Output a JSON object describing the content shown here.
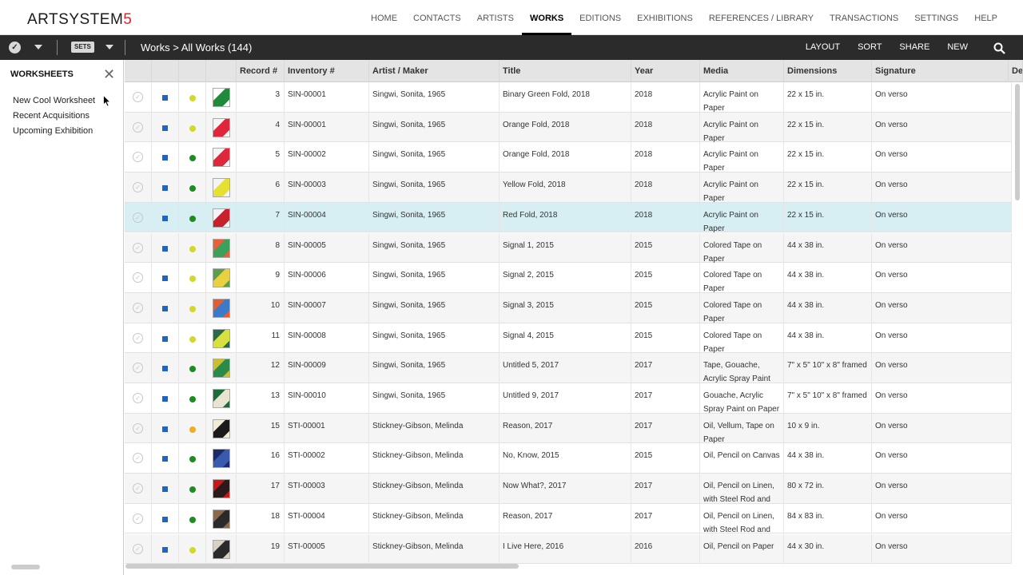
{
  "app": {
    "logo_text": "ARTSYSTEM",
    "logo_number": "5",
    "logo_number_color": "#e0242a"
  },
  "nav": {
    "items": [
      "HOME",
      "CONTACTS",
      "ARTISTS",
      "WORKS",
      "EDITIONS",
      "EXHIBITIONS",
      "REFERENCES / LIBRARY",
      "TRANSACTIONS",
      "SETTINGS",
      "HELP"
    ],
    "active": "WORKS"
  },
  "toolbar": {
    "sets_label": "SETS",
    "breadcrumb": "Works > All Works (144)",
    "actions": [
      "LAYOUT",
      "SORT",
      "SHARE",
      "NEW"
    ],
    "search_icon": "search-icon"
  },
  "sidebar": {
    "title": "WORKSHEETS",
    "close_icon": "close-icon",
    "items": [
      "New Cool Worksheet",
      "Recent Acquisitions",
      "Upcoming Exhibition"
    ]
  },
  "table": {
    "columns": [
      "",
      "",
      "",
      "",
      "Record #",
      "Inventory #",
      "Artist / Maker",
      "Title",
      "Year",
      "Media",
      "Dimensions",
      "Signature",
      "De"
    ],
    "colors": {
      "square": "#1b64c8",
      "green": "#1e8c1e",
      "yellow": "#d4d829",
      "orange": "#f0ad20",
      "selected_row": "#d7eff3"
    },
    "rows": [
      {
        "record": "3",
        "inventory": "SIN-00001",
        "artist": "Singwi, Sonita, 1965",
        "title": "Binary Green Fold, 2018",
        "year": "2018",
        "media": "Acrylic Paint on Paper",
        "dimensions": "22 x 15 in.",
        "signature": "On verso",
        "status": "yellow",
        "thumb": [
          "#ffffff",
          "#1f8a3a"
        ]
      },
      {
        "record": "4",
        "inventory": "SIN-00001",
        "artist": "Singwi, Sonita, 1965",
        "title": "Orange Fold, 2018",
        "year": "2018",
        "media": "Acrylic Paint on Paper",
        "dimensions": "22 x 15 in.",
        "signature": "On verso",
        "status": "yellow",
        "thumb": [
          "#f4f4f4",
          "#e0263a"
        ]
      },
      {
        "record": "5",
        "inventory": "SIN-00002",
        "artist": "Singwi, Sonita, 1965",
        "title": "Orange Fold, 2018",
        "year": "2018",
        "media": "Acrylic Paint on Paper",
        "dimensions": "22 x 15 in.",
        "signature": "On verso",
        "status": "green",
        "thumb": [
          "#f4f4f4",
          "#e0263a"
        ]
      },
      {
        "record": "6",
        "inventory": "SIN-00003",
        "artist": "Singwi, Sonita, 1965",
        "title": "Yellow Fold, 2018",
        "year": "2018",
        "media": "Acrylic Paint on Paper",
        "dimensions": "22 x 15 in.",
        "signature": "On verso",
        "status": "green",
        "thumb": [
          "#f4f4f4",
          "#e6e031"
        ]
      },
      {
        "record": "7",
        "inventory": "SIN-00004",
        "artist": "Singwi, Sonita, 1965",
        "title": "Red Fold, 2018",
        "year": "2018",
        "media": "Acrylic Paint on Paper",
        "dimensions": "22 x 15 in.",
        "signature": "On verso",
        "status": "green",
        "thumb": [
          "#f4f4f4",
          "#c8202c"
        ],
        "selected": true
      },
      {
        "record": "8",
        "inventory": "SIN-00005",
        "artist": "Singwi, Sonita, 1965",
        "title": "Signal 1, 2015",
        "year": "2015",
        "media": "Colored Tape on Paper",
        "dimensions": "44 x 38 in.",
        "signature": "On verso",
        "status": "yellow",
        "thumb": [
          "#e8603a",
          "#3aa05a"
        ]
      },
      {
        "record": "9",
        "inventory": "SIN-00006",
        "artist": "Singwi, Sonita, 1965",
        "title": "Signal 2, 2015",
        "year": "2015",
        "media": "Colored Tape on Paper",
        "dimensions": "44 x 38 in.",
        "signature": "On verso",
        "status": "yellow",
        "thumb": [
          "#5aa04a",
          "#e8d040"
        ]
      },
      {
        "record": "10",
        "inventory": "SIN-00007",
        "artist": "Singwi, Sonita, 1965",
        "title": "Signal 3, 2015",
        "year": "2015",
        "media": "Colored Tape on Paper",
        "dimensions": "44 x 38 in.",
        "signature": "On verso",
        "status": "yellow",
        "thumb": [
          "#e85a30",
          "#3a7ac8"
        ]
      },
      {
        "record": "11",
        "inventory": "SIN-00008",
        "artist": "Singwi, Sonita, 1965",
        "title": "Signal 4, 2015",
        "year": "2015",
        "media": "Colored Tape on Paper",
        "dimensions": "44 x 38 in.",
        "signature": "On verso",
        "status": "yellow",
        "thumb": [
          "#2a6a4a",
          "#d8e040"
        ]
      },
      {
        "record": "12",
        "inventory": "SIN-00009",
        "artist": "Singwi, Sonita, 1965",
        "title": "Untitled 5, 2017",
        "year": "2017",
        "media": "Tape, Gouache, Acrylic Spray Paint",
        "dimensions": "7\" x 5\" 10\" x 8\" framed",
        "signature": "On verso",
        "status": "green",
        "thumb": [
          "#c8c030",
          "#2a8a4a"
        ]
      },
      {
        "record": "13",
        "inventory": "SIN-00010",
        "artist": "Singwi, Sonita, 1965",
        "title": "Untitled 9, 2017",
        "year": "2017",
        "media": "Gouache, Acrylic Spray Paint on Paper",
        "dimensions": "7\" x 5\" 10\" x 8\" framed",
        "signature": "On verso",
        "status": "green",
        "thumb": [
          "#1f6a3a",
          "#e8e4d0"
        ]
      },
      {
        "record": "15",
        "inventory": "STI-00001",
        "artist": "Stickney-Gibson, Melinda",
        "title": "Reason, 2017",
        "year": "2017",
        "media": "Oil, Vellum, Tape on Paper",
        "dimensions": "10 x 9 in.",
        "signature": "On verso",
        "status": "orange",
        "thumb": [
          "#f0ecd8",
          "#1a1a1a"
        ]
      },
      {
        "record": "16",
        "inventory": "STI-00002",
        "artist": "Stickney-Gibson, Melinda",
        "title": "No, Know, 2015",
        "year": "2015",
        "media": "Oil, Pencil on Canvas",
        "dimensions": "44 x 38 in.",
        "signature": "On verso",
        "status": "green",
        "thumb": [
          "#1a2a6a",
          "#3a5ab0"
        ]
      },
      {
        "record": "17",
        "inventory": "STI-00003",
        "artist": "Stickney-Gibson, Melinda",
        "title": "Now What?, 2017",
        "year": "2017",
        "media": "Oil, Pencil on Linen, with Steel Rod and",
        "dimensions": "80 x 72 in.",
        "signature": "On verso",
        "status": "green",
        "thumb": [
          "#c81818",
          "#2a1a1a"
        ]
      },
      {
        "record": "18",
        "inventory": "STI-00004",
        "artist": "Stickney-Gibson, Melinda",
        "title": "Reason, 2017",
        "year": "2017",
        "media": "Oil, Pencil on Linen, with Steel Rod and",
        "dimensions": "84 x 83 in.",
        "signature": "On verso",
        "status": "green",
        "thumb": [
          "#8a6a4a",
          "#2a2a2a"
        ]
      },
      {
        "record": "19",
        "inventory": "STI-00005",
        "artist": "Stickney-Gibson, Melinda",
        "title": "I Live Here, 2016",
        "year": "2016",
        "media": "Oil, Pencil on Paper",
        "dimensions": "44 x 30 in.",
        "signature": "On verso",
        "status": "yellow",
        "thumb": [
          "#d8d0c0",
          "#2a2a2a"
        ]
      }
    ]
  }
}
